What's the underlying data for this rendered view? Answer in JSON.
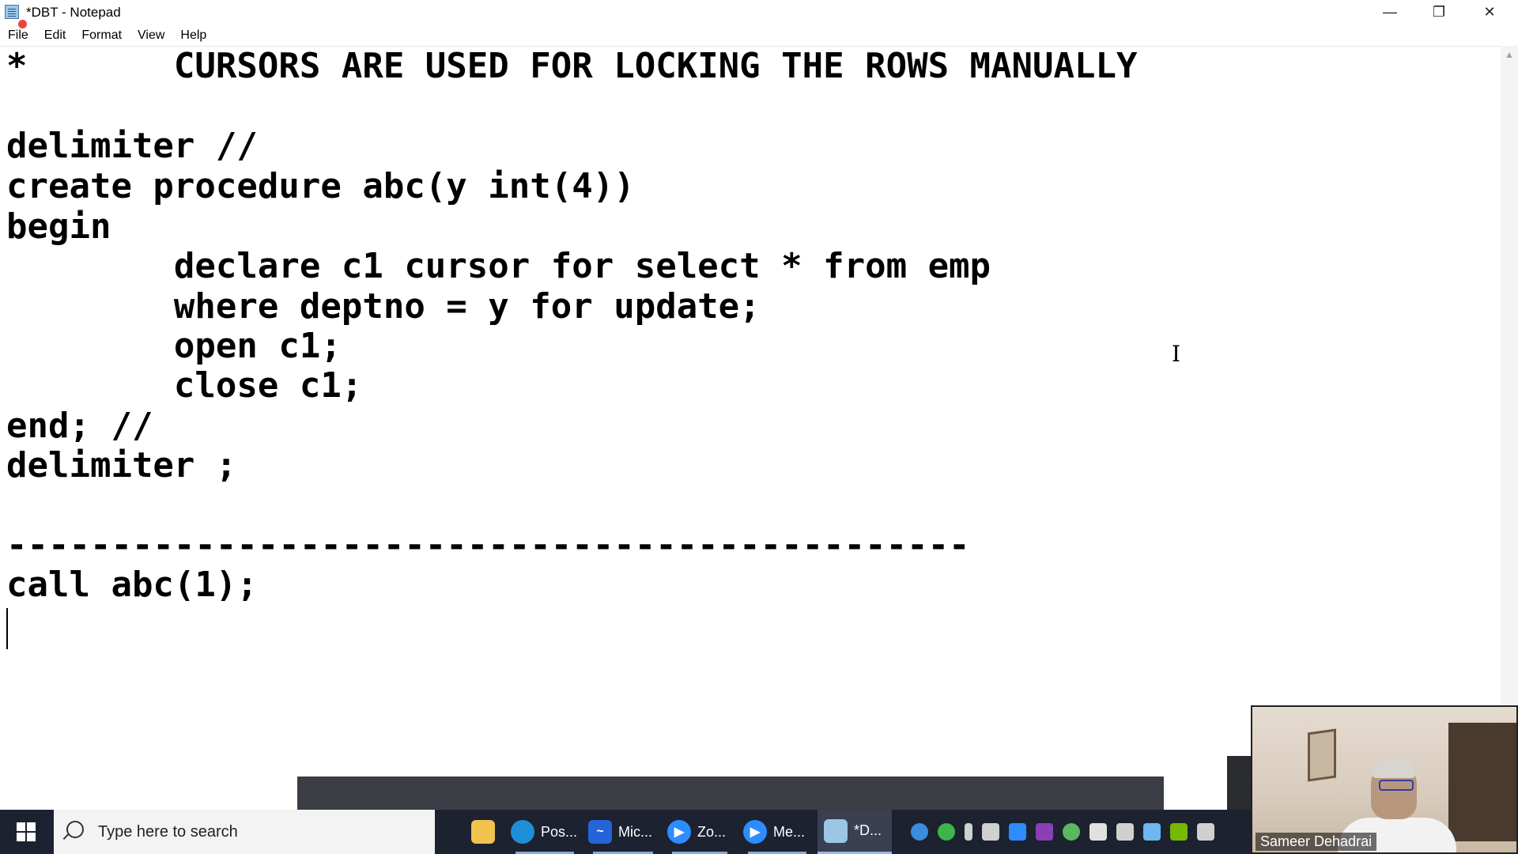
{
  "window": {
    "title": "*DBT - Notepad",
    "minimize_glyph": "—",
    "restore_glyph": "❐",
    "close_glyph": "✕"
  },
  "menu": [
    "File",
    "Edit",
    "Format",
    "View",
    "Help"
  ],
  "editor": {
    "lines": [
      "*       CURSORS ARE USED FOR LOCKING THE ROWS MANUALLY",
      "",
      "delimiter //",
      "create procedure abc(y int(4))",
      "begin",
      "        declare c1 cursor for select * from emp",
      "        where deptno = y for update;",
      "        open c1;",
      "        close c1;",
      "end; //",
      "delimiter ;",
      "",
      "----------------------------------------------",
      "call abc(1);"
    ]
  },
  "taskbar": {
    "search_placeholder": "Type here to search",
    "apps": [
      {
        "label": "",
        "icon": "file-explorer-icon",
        "color": "#f2c14e"
      },
      {
        "label": "Pos...",
        "icon": "edge-icon",
        "color": "#1e8fd6"
      },
      {
        "label": "Mic...",
        "icon": "whiteboard-icon",
        "color": "#2564d8"
      },
      {
        "label": "Zo...",
        "icon": "zoom-icon",
        "color": "#2d8cff"
      },
      {
        "label": "Me...",
        "icon": "zoom-meeting-icon",
        "color": "#2d8cff"
      },
      {
        "label": "*D...",
        "icon": "notepad-icon",
        "color": "#9cc6e6"
      }
    ],
    "tray_icons": [
      {
        "name": "help-icon",
        "color": "#3a8de0"
      },
      {
        "name": "check-icon",
        "color": "#3cb54a"
      },
      {
        "name": "microphone-icon",
        "color": "#d0d0d0"
      },
      {
        "name": "usb-icon",
        "color": "#d0d0d0"
      },
      {
        "name": "zoom-tray-icon",
        "color": "#2d8cff"
      },
      {
        "name": "onenote-icon",
        "color": "#8a3fb5"
      },
      {
        "name": "utorrent-icon",
        "color": "#5cb85c"
      },
      {
        "name": "security-icon",
        "color": "#e0e0e0"
      },
      {
        "name": "wifi-icon",
        "color": "#d0d0d0"
      },
      {
        "name": "snowflake-icon",
        "color": "#6fb7f0"
      },
      {
        "name": "nvidia-icon",
        "color": "#76b900"
      },
      {
        "name": "tablet-icon",
        "color": "#d0d0d0"
      },
      {
        "name": "app-tray-icon",
        "color": "#4aa3df"
      }
    ]
  },
  "webcam": {
    "name": "Sameer Dehadrai"
  }
}
